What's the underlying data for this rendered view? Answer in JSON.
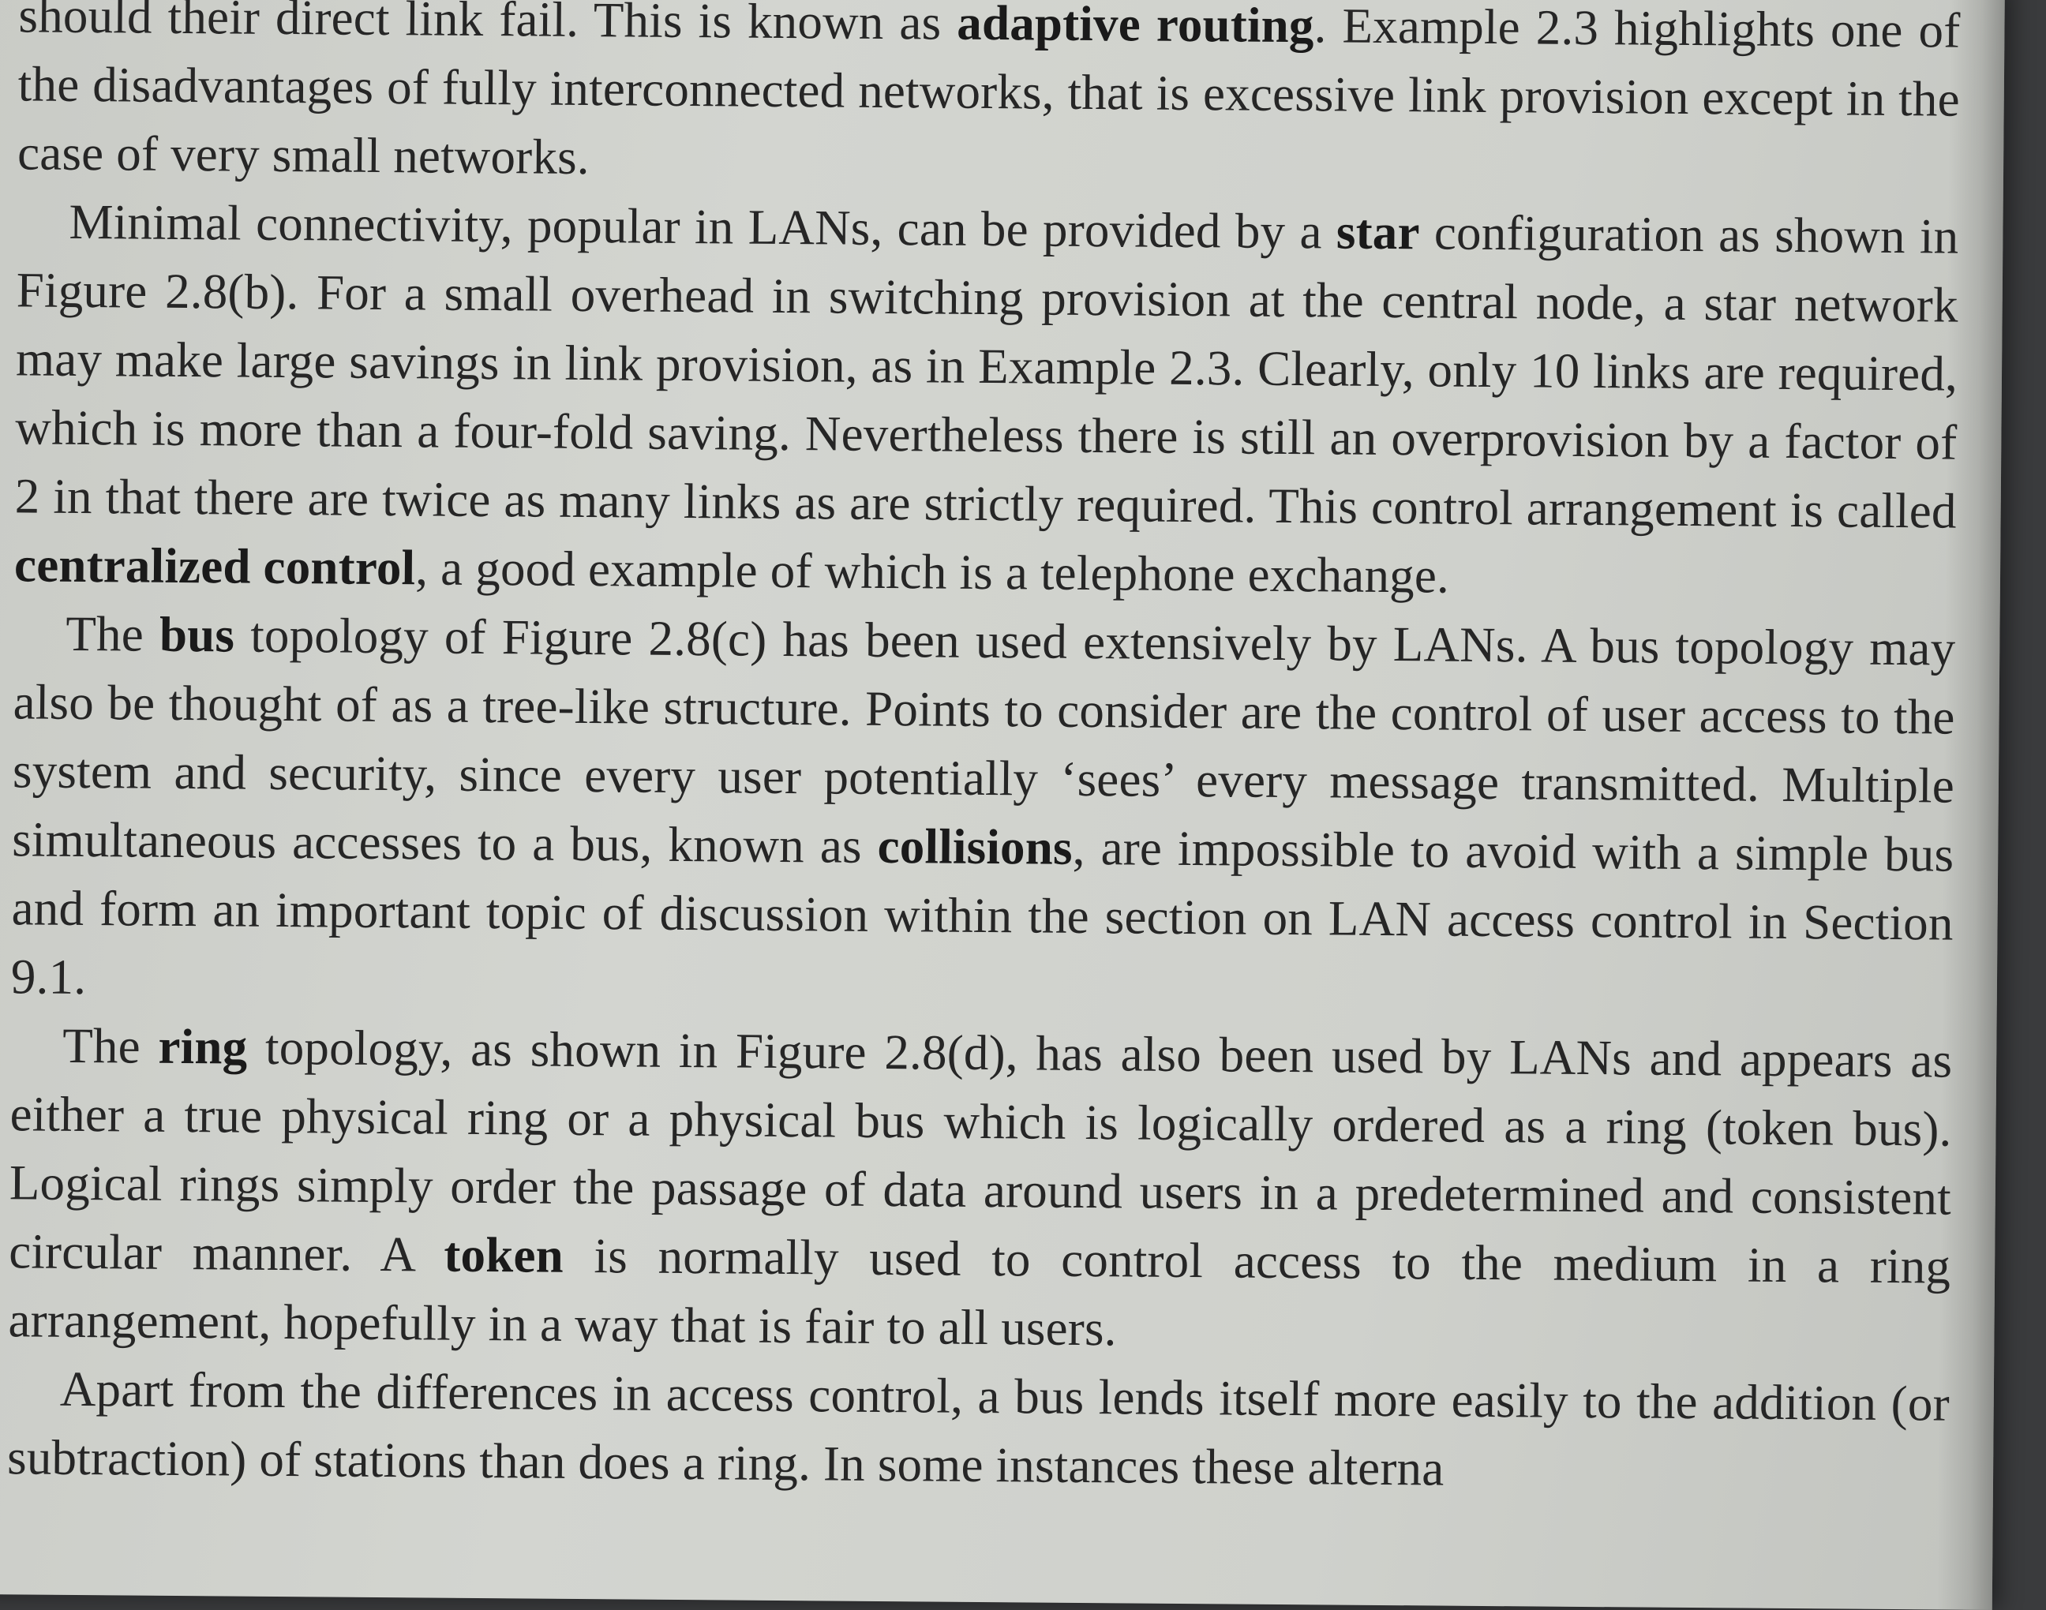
{
  "document": {
    "paragraphs": [
      {
        "id": "p0",
        "segments": [
          {
            "t": "should their direct link fail. This is known as ",
            "b": false
          },
          {
            "t": "adaptive routing",
            "b": true
          },
          {
            "t": ". Example 2.3 highlights one of the disadvantages of fully interconnected networks, that is excessive link provision except in the case of very small networks.",
            "b": false
          }
        ]
      },
      {
        "id": "p1",
        "segments": [
          {
            "t": "Minimal connectivity, popular in LANs, can be provided by a ",
            "b": false
          },
          {
            "t": "star",
            "b": true
          },
          {
            "t": " configuration as shown in Figure 2.8(b). For a small overhead in switching provision at the central node, a star network may make large savings in link provision, as in Example 2.3. Clearly, only 10 links are required, which is more than a four-fold saving. Nevertheless there is still an overprovision by a factor of 2 in that there are twice as many links as are strictly required. This control arrangement is called ",
            "b": false
          },
          {
            "t": "centralized control",
            "b": true
          },
          {
            "t": ", a good example of which is a telephone exchange.",
            "b": false
          }
        ]
      },
      {
        "id": "p2",
        "segments": [
          {
            "t": "The ",
            "b": false
          },
          {
            "t": "bus",
            "b": true
          },
          {
            "t": " topology of Figure 2.8(c) has been used extensively by LANs. A bus topology may also be thought of as a tree-like structure. Points to consider are the control of user access to the system and security, since every user potentially ‘sees’ every message transmitted. Multiple simultaneous accesses to a bus, known as ",
            "b": false
          },
          {
            "t": "collisions",
            "b": true
          },
          {
            "t": ", are impossible to avoid with a simple bus and form an important topic of discussion within the section on LAN access control in Section 9.1.",
            "b": false
          }
        ]
      },
      {
        "id": "p3",
        "segments": [
          {
            "t": "The ",
            "b": false
          },
          {
            "t": "ring",
            "b": true
          },
          {
            "t": " topology, as shown in Figure 2.8(d), has also been used by LANs and appears as either a true physical ring or a physical bus which is logically ordered as a ring (token bus). Logical rings simply order the passage of data around users in a predetermined and consistent circular manner. A ",
            "b": false
          },
          {
            "t": "token",
            "b": true
          },
          {
            "t": " is normally used to control access to the medium in a ring arrangement, hopefully in a way that is fair to all users.",
            "b": false
          }
        ]
      },
      {
        "id": "p4",
        "segments": [
          {
            "t": "Apart from the differences in access control, a bus lends itself more easily to the addition (or subtraction) of stations than does a ring. In some instances these alterna",
            "b": false
          }
        ]
      }
    ]
  }
}
